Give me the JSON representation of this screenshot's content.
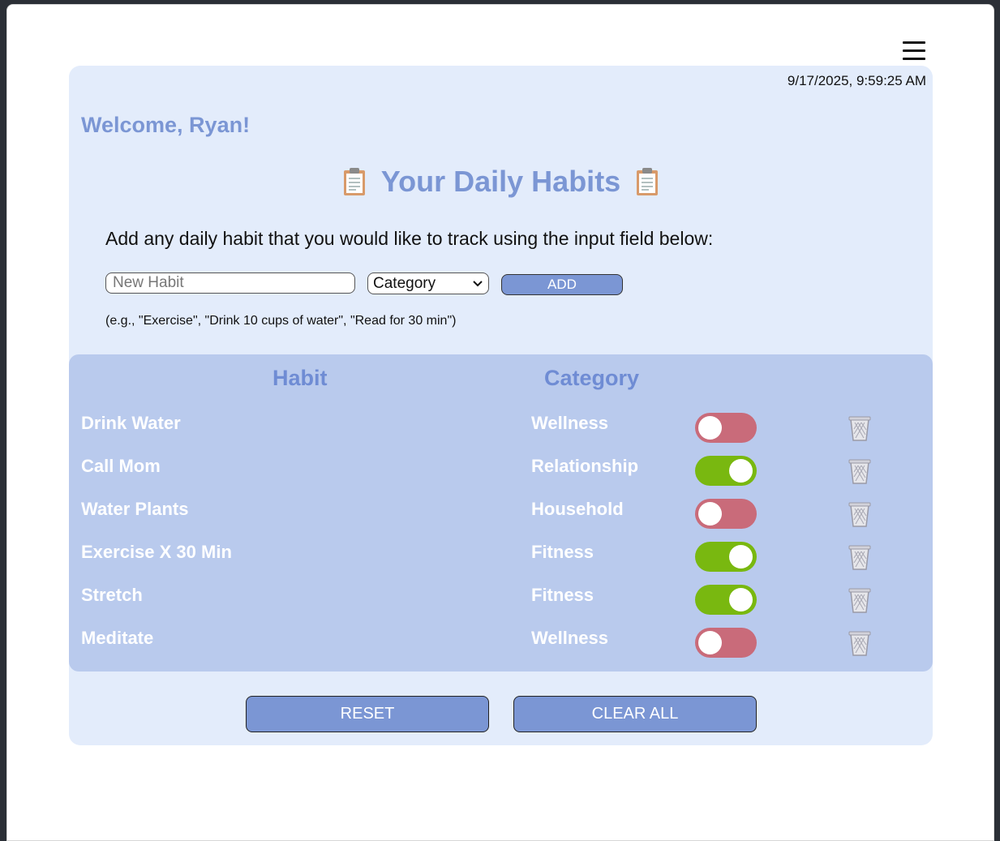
{
  "header": {
    "datetime": "9/17/2025, 9:59:25 AM",
    "menu_icon": "hamburger-menu-icon"
  },
  "welcome": "Welcome, Ryan!",
  "title": "Your Daily Habits",
  "title_icon": "clipboard-icon",
  "instructions": "Add any daily habit that you would like to track using the input field below:",
  "form": {
    "habit_placeholder": "New Habit",
    "category_selected": "Category",
    "add_label": "ADD"
  },
  "example": "(e.g., \"Exercise\", \"Drink 10 cups of water\", \"Read for 30 min\")",
  "table": {
    "headers": {
      "habit": "Habit",
      "category": "Category"
    },
    "rows": [
      {
        "habit": "Drink Water",
        "category": "Wellness",
        "done": false
      },
      {
        "habit": "Call Mom",
        "category": "Relationship",
        "done": true
      },
      {
        "habit": "Water Plants",
        "category": "Household",
        "done": false
      },
      {
        "habit": "Exercise X 30 Min",
        "category": "Fitness",
        "done": true
      },
      {
        "habit": "Stretch",
        "category": "Fitness",
        "done": true
      },
      {
        "habit": "Meditate",
        "category": "Wellness",
        "done": false
      }
    ]
  },
  "buttons": {
    "reset": "RESET",
    "clear_all": "CLEAR ALL"
  },
  "colors": {
    "accent": "#7b96d4",
    "toggle_on": "#79b810",
    "toggle_off": "#c96b7a",
    "card_bg": "#e3ecfb",
    "table_bg": "#b9caed"
  }
}
